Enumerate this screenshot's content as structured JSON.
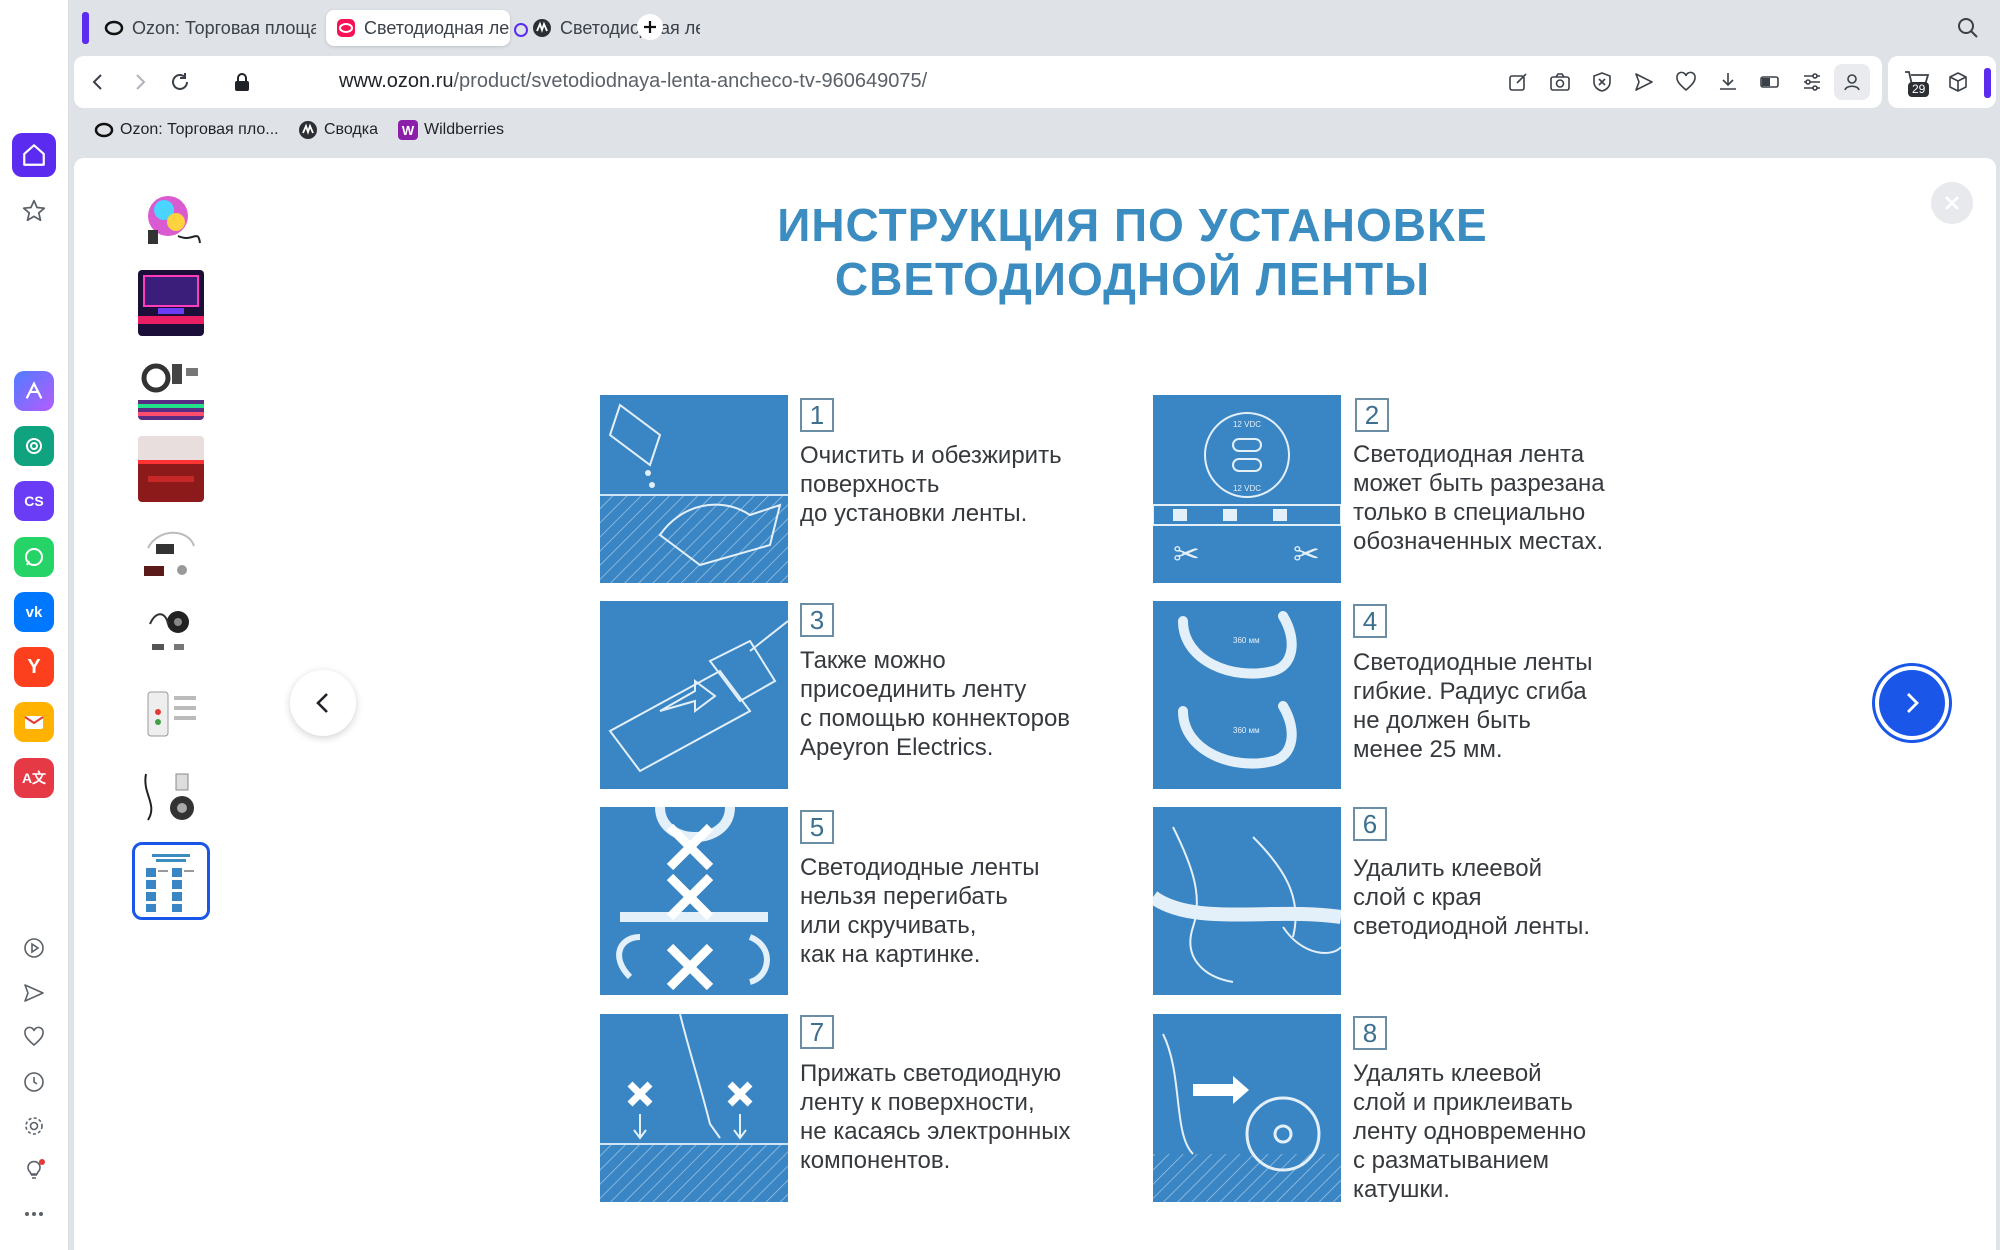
{
  "browser": {
    "tabs": [
      {
        "title": "Ozon: Торговая площадка",
        "active": false,
        "favicon": "ozon-ring-icon"
      },
      {
        "title": "Светодиодная лента anch",
        "active": true,
        "favicon": "ozon-logo-icon"
      },
      {
        "title": "Светодиодная лента с",
        "active": false,
        "favicon": "svodka-icon"
      }
    ],
    "new_tab_icon": "plus-icon",
    "url": {
      "host": "www.ozon.ru",
      "path": "/product/svetodiodnaya-lenta-ancheco-tv-960649075/"
    },
    "cart_badge": "29",
    "bookmarks": [
      {
        "label": "Ozon: Торговая пло...",
        "favicon": "ozon-ring-icon"
      },
      {
        "label": "Сводка",
        "favicon": "svodka-icon"
      },
      {
        "label": "Wildberries",
        "favicon": "wildberries-icon"
      }
    ]
  },
  "sidebar": {
    "apps": [
      {
        "name": "home",
        "color": "#5b2bf0"
      },
      {
        "name": "favorites"
      },
      {
        "name": "aitools",
        "color": "#5a6cf0"
      },
      {
        "name": "chatgpt",
        "color": "#10a37f"
      },
      {
        "name": "cs",
        "color": "#6a3cf5",
        "label": "CS"
      },
      {
        "name": "whatsapp",
        "color": "#25d366"
      },
      {
        "name": "vk",
        "color": "#0077ff"
      },
      {
        "name": "yandex",
        "color": "#fc3f1d"
      },
      {
        "name": "mail",
        "color": "#ffb300"
      },
      {
        "name": "translator",
        "color": "#e63946"
      }
    ]
  },
  "viewer": {
    "thumbnail_count": 9,
    "selected_thumbnail": 9
  },
  "instruction": {
    "title_line1": "ИНСТРУКЦИЯ ПО УСТАНОВКЕ",
    "title_line2": "СВЕТОДИОДНОЙ ЛЕНТЫ",
    "steps": [
      {
        "num": "1",
        "text": "Очистить и обезжирить\nповерхность\nдо установки ленты."
      },
      {
        "num": "2",
        "text": "Светодиодная лента\nможет быть разрезана\nтолько в специально\nобозначенных местах."
      },
      {
        "num": "3",
        "text": "Также можно\nприсоединить ленту\nс помощью коннекторов\nApeyron Electrics."
      },
      {
        "num": "4",
        "text": "Светодиодные ленты\nгибкие. Радиус сгиба\nне должен быть\nменее 25 мм."
      },
      {
        "num": "5",
        "text": "Светодиодные ленты\nнельзя перегибать\nили скручивать,\nкак на картинке."
      },
      {
        "num": "6",
        "text": "Удалить клеевой\nслой с края\nсветодиодной ленты."
      },
      {
        "num": "7",
        "text": "Прижать светодиодную\nленту к поверхности,\nне касаясь электронных\nкомпонентов."
      },
      {
        "num": "8",
        "text": "Удалять клеевой\nслой и приклеивать\nленту одновременно\nс разматыванием\nкатушки."
      }
    ],
    "diagram_labels": {
      "dc_top": "12 VDC",
      "dc_bottom": "12 VDC",
      "radius_top": "360 мм",
      "radius_bottom": "360 мм"
    }
  },
  "colors": {
    "accent": "#1a56e8",
    "instruction_blue": "#3a85c3",
    "title_blue": "#3a8cc1"
  }
}
